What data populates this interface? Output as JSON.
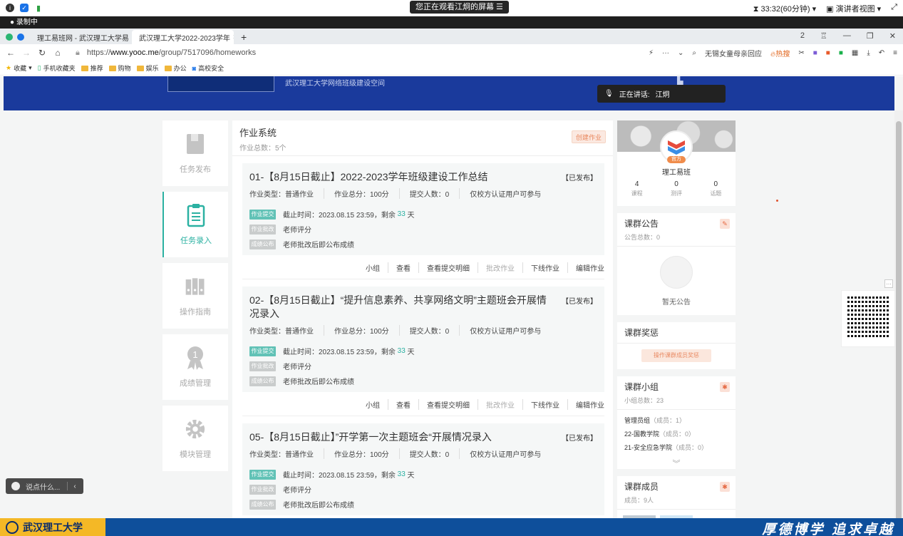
{
  "meeting": {
    "watching_text": "您正在观看江炯的屏幕",
    "timer": "33:32(60分钟)",
    "view_mode": "演讲者视图",
    "recording": "录制中",
    "speaking_label": "正在讲话:",
    "speaking_name": "江炯"
  },
  "browser": {
    "tabs": [
      {
        "title": "理工易班网 - 武汉理工大学易"
      },
      {
        "title": "武汉理工大学2022-2023学年"
      }
    ],
    "tab_count": "2",
    "url_prefix": "https://",
    "url_host": "www.yooc.me",
    "url_path": "/group/7517096/homeworks",
    "search_hint": "无锡女童母亲回应",
    "hot_label": "热搜",
    "bookmarks": [
      "收藏",
      "手机收藏夹",
      "推荐",
      "购物",
      "娱乐",
      "办公",
      "高校安全"
    ]
  },
  "banner": {
    "subtitle": "武汉理工大学网络班级建设空间"
  },
  "menu": [
    {
      "label": "任务发布",
      "icon": "book-icon",
      "active": false
    },
    {
      "label": "任务录入",
      "icon": "clipboard-icon",
      "active": true
    },
    {
      "label": "操作指南",
      "icon": "binders-icon",
      "active": false
    },
    {
      "label": "成绩管理",
      "icon": "medal-icon",
      "active": false
    },
    {
      "label": "模块管理",
      "icon": "gear-icon",
      "active": false
    }
  ],
  "main": {
    "title": "作业系统",
    "count": "作业总数：5个",
    "create_label": "创建作业",
    "homeworks": [
      {
        "title": "01-【8月15日截止】2022-2023学年班级建设工作总结",
        "status": "【已发布】",
        "type": "作业类型：普通作业",
        "score": "作业总分：100分",
        "submits": "提交人数：0",
        "scope": "仅校方认证用户可参与",
        "deadline": "截止时间：2023.08.15 23:59，剩余",
        "remaining": "33",
        "days": "天",
        "grading": "老师评分",
        "publish": "老师批改后即公布成绩"
      },
      {
        "title": "02-【8月15日截止】“提升信息素养、共享网络文明”主题班会开展情况录入",
        "status": "【已发布】",
        "type": "作业类型：普通作业",
        "score": "作业总分：100分",
        "submits": "提交人数：0",
        "scope": "仅校方认证用户可参与",
        "deadline": "截止时间：2023.08.15 23:59，剩余",
        "remaining": "33",
        "days": "天",
        "grading": "老师评分",
        "publish": "老师批改后即公布成绩"
      },
      {
        "title": "05-【8月15日截止】”开学第一次主题班会“开展情况录入",
        "status": "【已发布】",
        "type": "作业类型：普通作业",
        "score": "作业总分：100分",
        "submits": "提交人数：0",
        "scope": "仅校方认证用户可参与",
        "deadline": "截止时间：2023.08.15 23:59，剩余",
        "remaining": "33",
        "days": "天",
        "grading": "老师评分",
        "publish": "老师批改后即公布成绩"
      }
    ],
    "step_tags": {
      "submit": "作业提交",
      "review": "作业批改",
      "grade": "成绩公布"
    },
    "actions": [
      "小组",
      "查看",
      "查看提交明细",
      "批改作业",
      "下线作业",
      "编辑作业"
    ]
  },
  "profile": {
    "name": "理工易班",
    "avatar_text": "理工易班",
    "badge": "官方",
    "stats": [
      {
        "n": "4",
        "l": "课程"
      },
      {
        "n": "0",
        "l": "测评"
      },
      {
        "n": "0",
        "l": "话题"
      }
    ]
  },
  "notice": {
    "title": "课群公告",
    "count": "公告总数：0",
    "empty": "暂无公告"
  },
  "reward": {
    "title": "课群奖惩",
    "button": "操作课群成员奖惩"
  },
  "groups": {
    "title": "课群小组",
    "count": "小组总数：23",
    "items": [
      {
        "name": "管理员组",
        "members": "（成员：1）"
      },
      {
        "name": "22-国教学院",
        "members": "（成员：0）"
      },
      {
        "name": "21-安全应急学院",
        "members": "（成员：0）"
      }
    ]
  },
  "members": {
    "title": "课群成员",
    "count": "成员：9人"
  },
  "chat": {
    "placeholder": "说点什么..."
  },
  "footer": {
    "university": "武汉理工大学",
    "motto": "厚德博学 追求卓越"
  },
  "colors": {
    "accent": "#2bb1a2",
    "banner": "#1a3a9c",
    "footer": "#0e4f9b"
  }
}
